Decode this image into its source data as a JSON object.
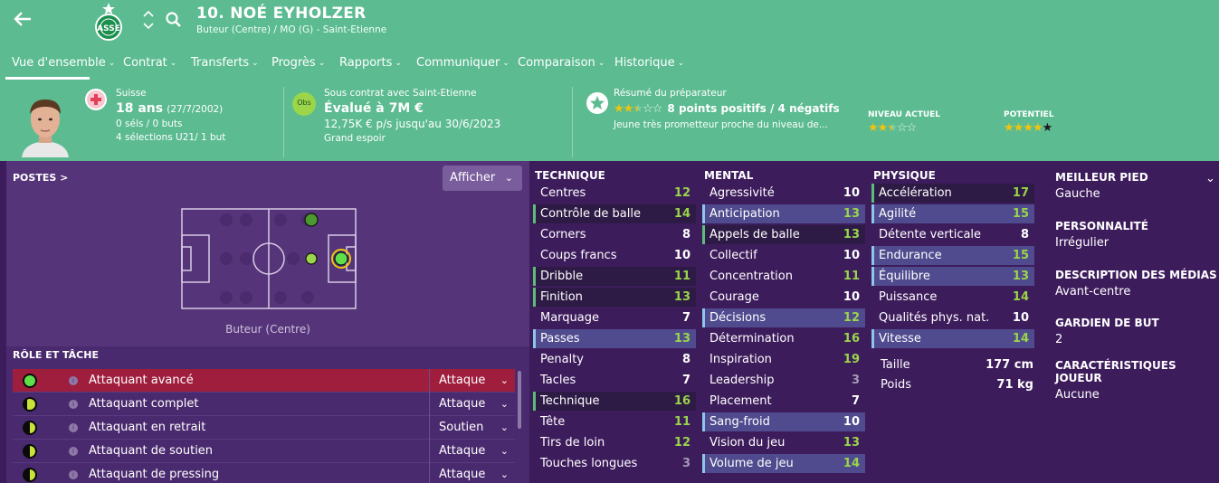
{
  "header": {
    "title": "10. NOÉ EYHOLZER",
    "subtitle": "Buteur (Centre) / MO (G) - Saint-Etienne"
  },
  "tabs": [
    {
      "label": "Vue d'ensemble"
    },
    {
      "label": "Contrat"
    },
    {
      "label": "Transferts"
    },
    {
      "label": "Progrès"
    },
    {
      "label": "Rapports"
    },
    {
      "label": "Communiquer"
    },
    {
      "label": "Comparaison"
    },
    {
      "label": "Historique"
    }
  ],
  "profile": {
    "nationality": "Suisse",
    "age": "18 ans",
    "dob": "(27/7/2002)",
    "caps": "0 séls / 0 buts",
    "u21": "4 sélections U21/ 1 but"
  },
  "contract": {
    "status": "Sous contrat avec Saint-Etienne",
    "value": "Évalué à 7M €",
    "wage": "12,75K € p/s jusqu'au 30/6/2023",
    "tag": "Grand espoir",
    "obs_label": "Obs"
  },
  "coach_report": {
    "title": "Résumé du préparateur",
    "summary": "8 points positifs / 4 négatifs",
    "desc": "Jeune très prometteur proche du niveau de...",
    "current_label": "NIVEAU ACTUEL",
    "potential_label": "POTENTIEL",
    "summary_stars": 2.5,
    "current_stars": 2.5,
    "potential_stars": 4.5
  },
  "positions": {
    "title": "POSTES",
    "title_arrow": ">",
    "button": "Afficher",
    "caption": "Buteur (Centre)"
  },
  "roles": {
    "title": "RÔLE ET TÂCHE",
    "items": [
      {
        "name": "Attaquant avancé",
        "duty": "Attaque",
        "level": 1.0
      },
      {
        "name": "Attaquant complet",
        "duty": "Attaque",
        "level": 0.75
      },
      {
        "name": "Attaquant en retrait",
        "duty": "Soutien",
        "level": 0.5
      },
      {
        "name": "Attaquant de soutien",
        "duty": "Attaque",
        "level": 0.5
      },
      {
        "name": "Attaquant de pressing",
        "duty": "Attaque",
        "level": 0.5
      }
    ]
  },
  "technique": {
    "title": "TECHNIQUE",
    "attrs": [
      {
        "name": "Centres",
        "value": "12"
      },
      {
        "name": "Contrôle de balle",
        "value": "14"
      },
      {
        "name": "Corners",
        "value": "8"
      },
      {
        "name": "Coups francs",
        "value": "10"
      },
      {
        "name": "Dribble",
        "value": "11"
      },
      {
        "name": "Finition",
        "value": "13"
      },
      {
        "name": "Marquage",
        "value": "7"
      },
      {
        "name": "Passes",
        "value": "13"
      },
      {
        "name": "Penalty",
        "value": "8"
      },
      {
        "name": "Tacles",
        "value": "7"
      },
      {
        "name": "Technique",
        "value": "16"
      },
      {
        "name": "Tête",
        "value": "11"
      },
      {
        "name": "Tirs de loin",
        "value": "12"
      },
      {
        "name": "Touches longues",
        "value": "3"
      }
    ]
  },
  "mental": {
    "title": "MENTAL",
    "attrs": [
      {
        "name": "Agressivité",
        "value": "10"
      },
      {
        "name": "Anticipation",
        "value": "13"
      },
      {
        "name": "Appels de balle",
        "value": "13"
      },
      {
        "name": "Collectif",
        "value": "10"
      },
      {
        "name": "Concentration",
        "value": "11"
      },
      {
        "name": "Courage",
        "value": "10"
      },
      {
        "name": "Décisions",
        "value": "12"
      },
      {
        "name": "Détermination",
        "value": "16"
      },
      {
        "name": "Inspiration",
        "value": "19"
      },
      {
        "name": "Leadership",
        "value": "3"
      },
      {
        "name": "Placement",
        "value": "7"
      },
      {
        "name": "Sang-froid",
        "value": "10"
      },
      {
        "name": "Vision du jeu",
        "value": "13"
      },
      {
        "name": "Volume de jeu",
        "value": "14"
      }
    ]
  },
  "physique": {
    "title": "PHYSIQUE",
    "attrs": [
      {
        "name": "Accélération",
        "value": "17"
      },
      {
        "name": "Agilité",
        "value": "15"
      },
      {
        "name": "Détente verticale",
        "value": "8"
      },
      {
        "name": "Endurance",
        "value": "15"
      },
      {
        "name": "Équilibre",
        "value": "13"
      },
      {
        "name": "Puissance",
        "value": "14"
      },
      {
        "name": "Qualités phys. nat.",
        "value": "10"
      },
      {
        "name": "Vitesse",
        "value": "14"
      }
    ],
    "height_label": "Taille",
    "height_value": "177 cm",
    "weight_label": "Poids",
    "weight_value": "71 kg"
  },
  "right_info": {
    "foot_label": "MEILLEUR PIED",
    "foot_value": "Gauche",
    "personality_label": "PERSONNALITÉ",
    "personality_value": "Irrégulier",
    "media_label": "DESCRIPTION DES MÉDIAS",
    "media_value": "Avant-centre",
    "gk_label": "GARDIEN DE BUT",
    "gk_value": "2",
    "traits_label": "CARACTÉRISTIQUES JOUEUR",
    "traits_value": "Aucune"
  },
  "colors": {
    "header_bg": "#5cbb91",
    "content_bg": "#3d1c5c",
    "selected_role": "#a01e3d",
    "good_value": "#9ad54a"
  }
}
